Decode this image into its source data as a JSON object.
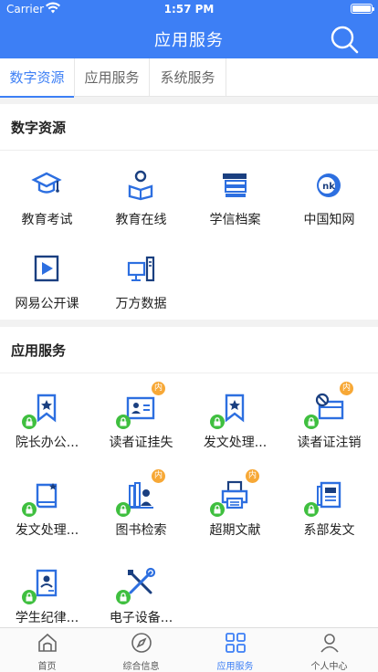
{
  "status": {
    "carrier": "Carrier",
    "time": "1:57 PM"
  },
  "header": {
    "title": "应用服务"
  },
  "tabs": [
    "数字资源",
    "应用服务",
    "系统服务"
  ],
  "sections": [
    {
      "title": "数字资源",
      "items": [
        {
          "label": "教育考试",
          "icon": "graduation-cap-icon"
        },
        {
          "label": "教育在线",
          "icon": "online-reading-icon"
        },
        {
          "label": "学信档案",
          "icon": "file-stack-icon"
        },
        {
          "label": "中国知网",
          "icon": "cnki-logo-icon"
        },
        {
          "label": "网易公开课",
          "icon": "video-play-icon"
        },
        {
          "label": "万方数据",
          "icon": "computer-tower-icon"
        }
      ]
    },
    {
      "title": "应用服务",
      "items": [
        {
          "label": "院长办公...",
          "icon": "bookmark-star-icon",
          "lock": true,
          "badge": ""
        },
        {
          "label": "读者证挂失",
          "icon": "id-card-icon",
          "lock": true,
          "badge": "内"
        },
        {
          "label": "发文处理...",
          "icon": "bookmark-star-icon",
          "lock": true,
          "badge": ""
        },
        {
          "label": "读者证注销",
          "icon": "card-cancel-icon",
          "lock": true,
          "badge": "内"
        },
        {
          "label": "发文处理...",
          "icon": "book-star-icon",
          "lock": true,
          "badge": ""
        },
        {
          "label": "图书检索",
          "icon": "book-search-icon",
          "lock": true,
          "badge": "内"
        },
        {
          "label": "超期文献",
          "icon": "printer-icon",
          "lock": true,
          "badge": "内"
        },
        {
          "label": "系部发文",
          "icon": "document-icon",
          "lock": true,
          "badge": ""
        },
        {
          "label": "学生纪律...",
          "icon": "person-card-icon",
          "lock": true,
          "badge": ""
        },
        {
          "label": "电子设备...",
          "icon": "tools-icon",
          "lock": true,
          "badge": ""
        }
      ]
    }
  ],
  "tabbar": [
    "首页",
    "综合信息",
    "应用服务",
    "个人中心"
  ],
  "colors": {
    "primary": "#3d7ff5",
    "lock": "#3fbf3f",
    "badge": "#f7a836"
  }
}
